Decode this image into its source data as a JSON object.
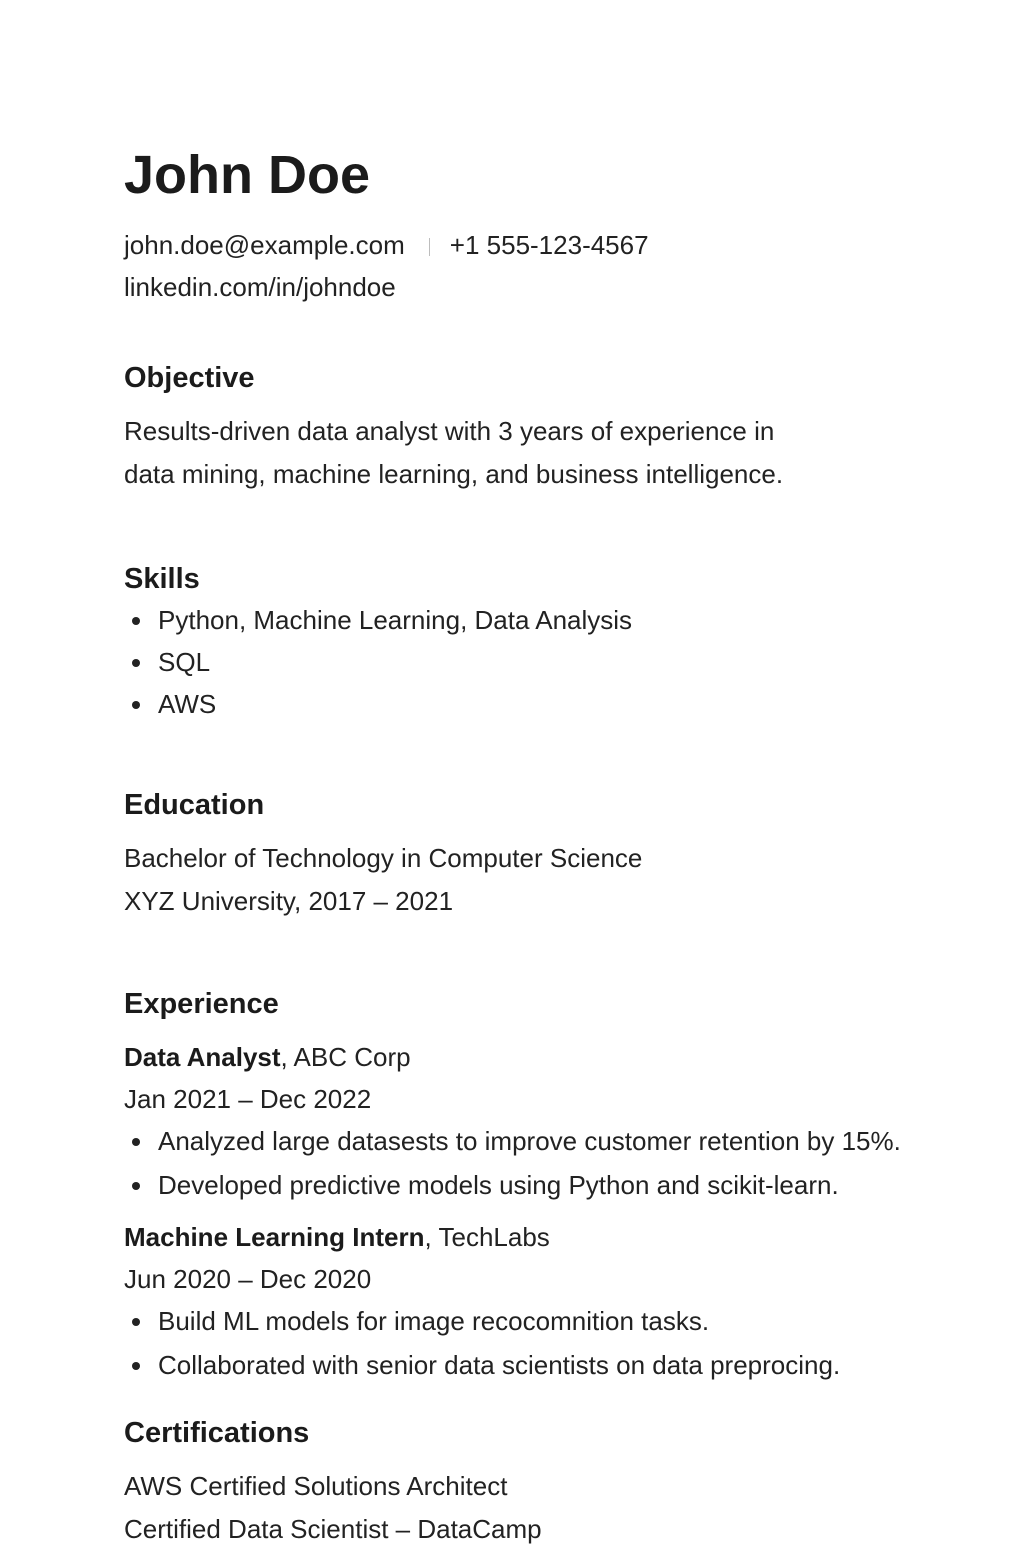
{
  "header": {
    "name": "John Doe",
    "email": "john.doe@example.com",
    "phone": "+1 555-123-4567",
    "linkedin": "linkedin.com/in/johndoe"
  },
  "objective": {
    "title": "Objective",
    "line1": "Results-driven data analyst with 3 years of experience in",
    "line2": "data mining, machine learning, and business intelligence."
  },
  "skills": {
    "title": "Skills",
    "items": [
      "Python, Machine Learning, Data Analysis",
      "SQL",
      "AWS"
    ]
  },
  "education": {
    "title": "Education",
    "degree": "Bachelor of Technology in Computer Science",
    "school": "XYZ University, 2017 – 2021"
  },
  "experience": {
    "title": "Experience",
    "jobs": [
      {
        "role": "Data Analyst",
        "company": ", ABC Corp",
        "dates": "Jan 2021 – Dec 2022",
        "bullets": [
          "Analyzed large datasests to improve customer retention by 15%.",
          "Developed predictive models using Python and scikit-learn."
        ]
      },
      {
        "role": "Machine Learning Intern",
        "company": ", TechLabs",
        "dates": "Jun 2020 – Dec 2020",
        "bullets": [
          "Build ML models for image recocomnition tasks.",
          "Collaborated with senior data scientists on data preprocing."
        ]
      }
    ]
  },
  "certifications": {
    "title": "Certifications",
    "items": [
      "AWS Certified Solutions Architect",
      "Certified Data Scientist – DataCamp"
    ]
  }
}
